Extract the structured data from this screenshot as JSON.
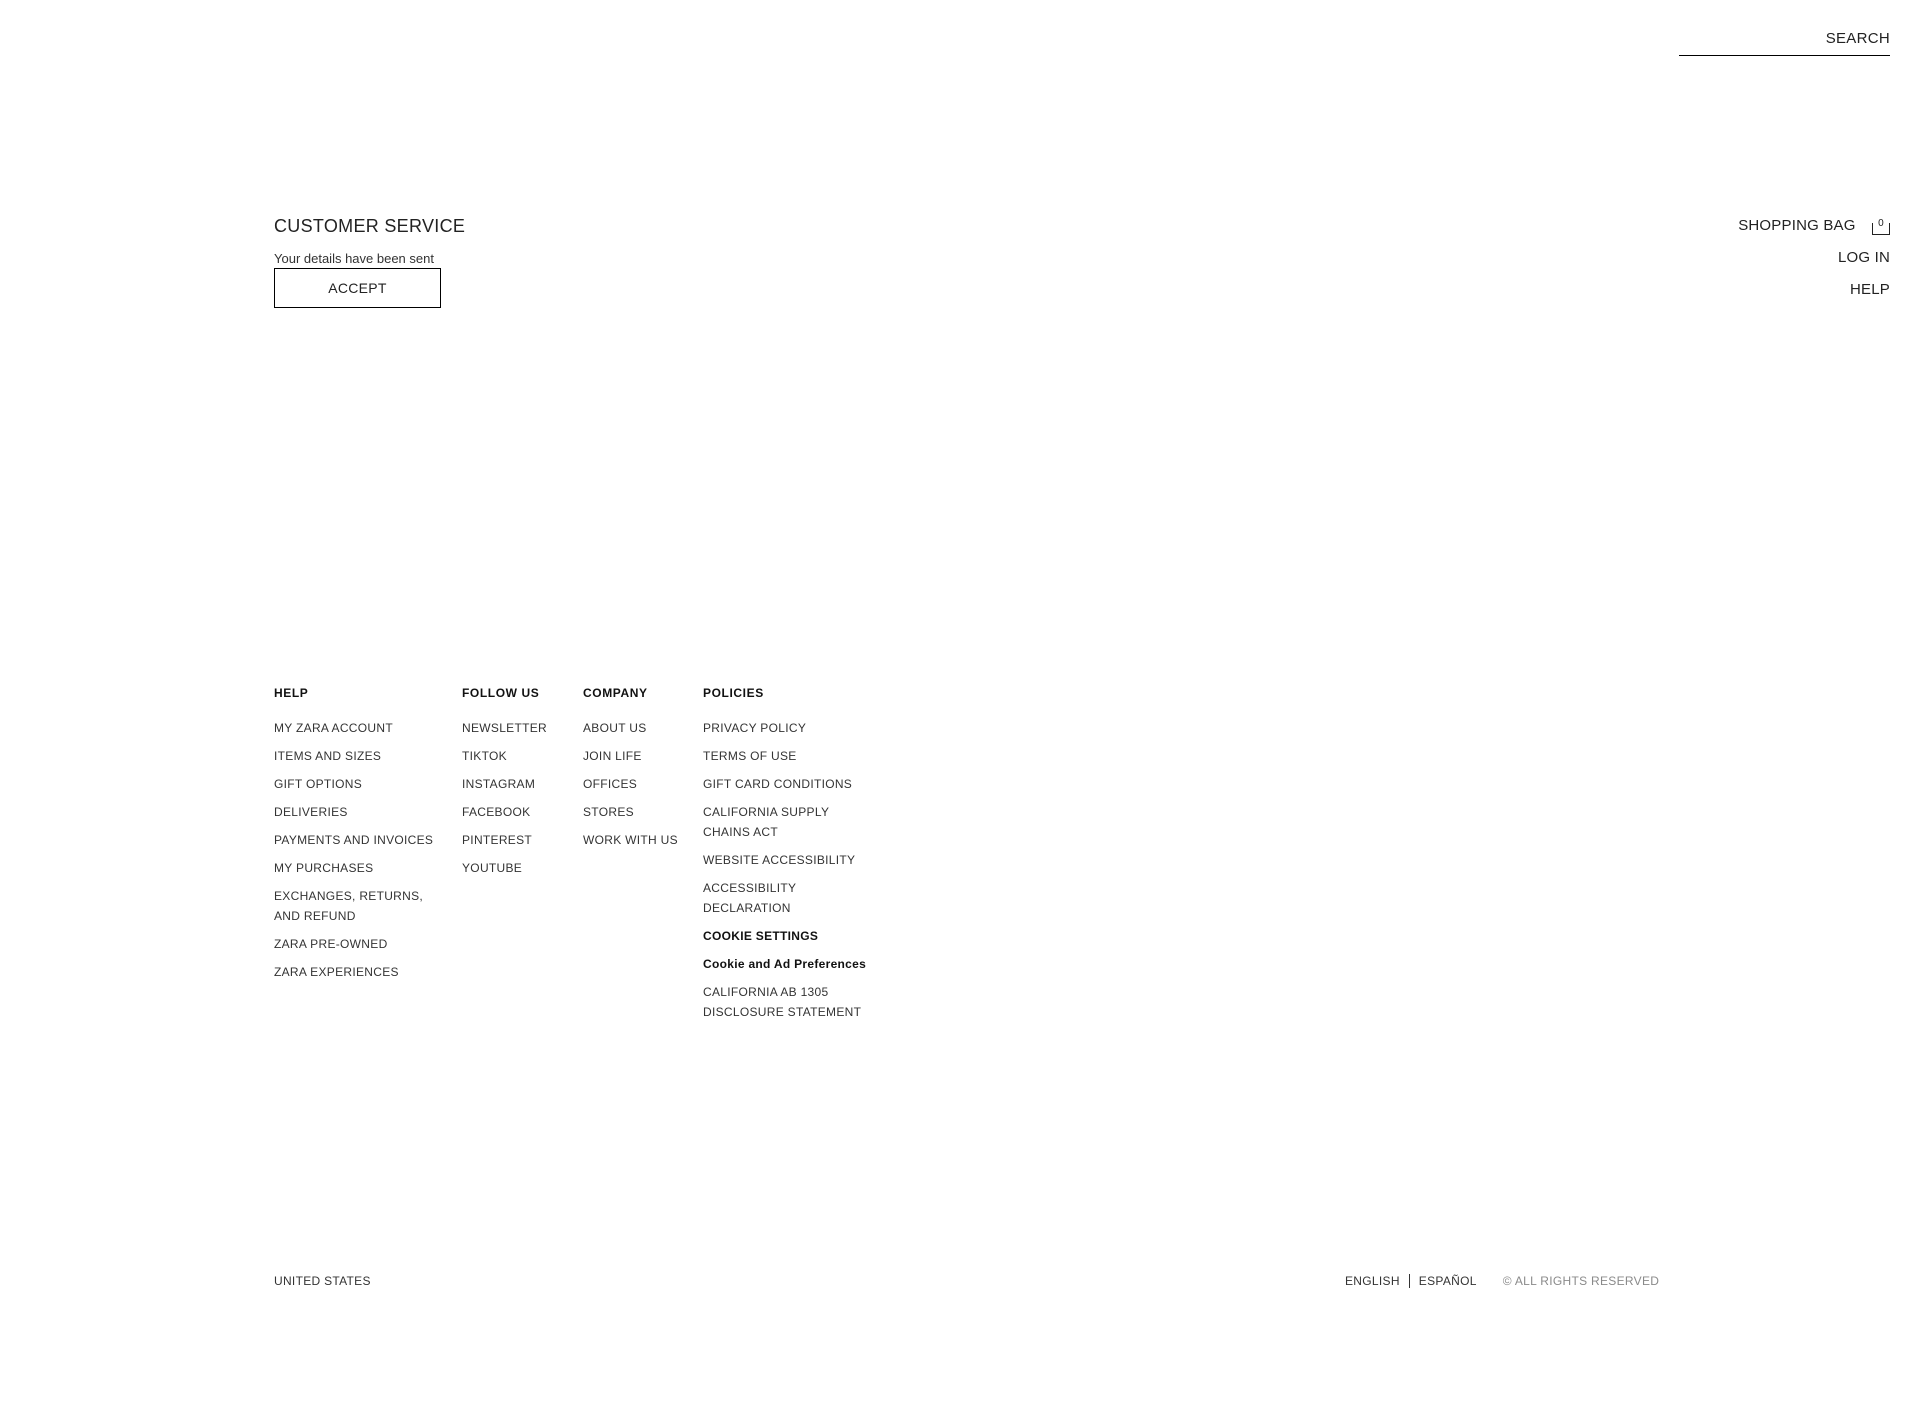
{
  "header": {
    "search_label": "SEARCH",
    "nav": {
      "shopping_bag_label": "SHOPPING BAG",
      "bag_count": "0",
      "login_label": "LOG IN",
      "help_label": "HELP"
    }
  },
  "main": {
    "title": "CUSTOMER SERVICE",
    "status_message": "Your details have been sent",
    "accept_label": "ACCEPT"
  },
  "footer": {
    "columns": [
      {
        "title": "HELP",
        "items": [
          "MY ZARA ACCOUNT",
          "ITEMS AND SIZES",
          "GIFT OPTIONS",
          "DELIVERIES",
          "PAYMENTS AND INVOICES",
          "MY PURCHASES",
          "EXCHANGES, RETURNS, AND REFUND",
          "ZARA PRE-OWNED",
          "ZARA EXPERIENCES"
        ]
      },
      {
        "title": "FOLLOW US",
        "items": [
          "NEWSLETTER",
          "TIKTOK",
          "INSTAGRAM",
          "FACEBOOK",
          "PINTEREST",
          "YOUTUBE"
        ]
      },
      {
        "title": "COMPANY",
        "items": [
          "ABOUT US",
          "JOIN LIFE",
          "OFFICES",
          "STORES",
          "WORK WITH US"
        ]
      },
      {
        "title": "POLICIES",
        "items": [
          "PRIVACY POLICY",
          "TERMS OF USE",
          "GIFT CARD CONDITIONS",
          "CALIFORNIA SUPPLY CHAINS ACT",
          "WEBSITE ACCESSIBILITY",
          "ACCESSIBILITY DECLARATION",
          "COOKIE SETTINGS",
          "Cookie and Ad Preferences",
          "CALIFORNIA AB 1305 DISCLOSURE STATEMENT"
        ]
      }
    ],
    "country": "UNITED STATES",
    "languages": [
      "ENGLISH",
      "ESPAÑOL"
    ],
    "rights": "© ALL RIGHTS RESERVED"
  }
}
